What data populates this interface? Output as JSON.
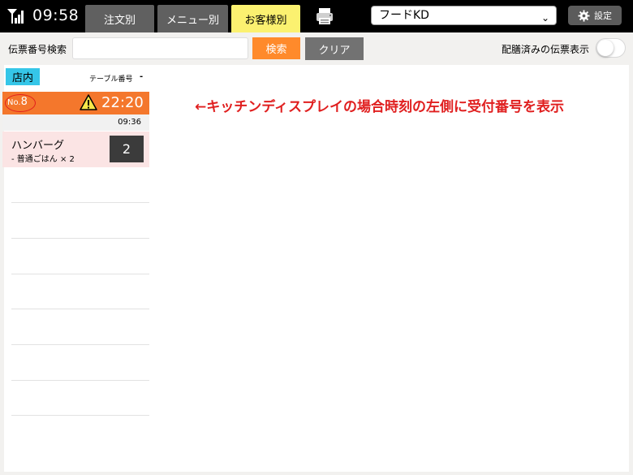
{
  "status_bar": {
    "time": "09:58",
    "signal_icon": "signal-icon"
  },
  "tabs": [
    {
      "label": "注文別",
      "active": false
    },
    {
      "label": "メニュー別",
      "active": false
    },
    {
      "label": "お客様別",
      "active": true
    }
  ],
  "printer_icon": "printer-icon",
  "store_select": {
    "value": "フードKD"
  },
  "settings": {
    "label": "設定",
    "icon": "gear-icon"
  },
  "search": {
    "label": "伝票番号検索",
    "input_value": "",
    "search_button": "検索",
    "clear_button": "クリア",
    "delivered_label": "配膳済みの伝票表示",
    "delivered_toggle_on": false
  },
  "order_list": {
    "section_badge": "店内",
    "table_header": "テーブル番号",
    "table_value": "-",
    "orders": [
      {
        "number_prefix": "No.",
        "number": "8",
        "warning_icon": "warning-icon",
        "elapsed_time": "22:20",
        "order_time": "09:36",
        "items": [
          {
            "name": "ハンバーグ",
            "option": "- 普通ごはん × 2",
            "quantity": "2"
          }
        ]
      }
    ]
  },
  "annotation": {
    "text": "←キッチンディスプレイの場合時刻の左側に受付番号を表示"
  },
  "colors": {
    "header_bg": "#000000",
    "active_tab": "#fbf170",
    "inactive_tab": "#606060",
    "search_button": "#ff8a2b",
    "clear_button": "#727272",
    "order_header": "#f4772c",
    "section_badge": "#35c6e8",
    "item_bg": "#fbe4e4",
    "annotation": "#e01f1f"
  }
}
